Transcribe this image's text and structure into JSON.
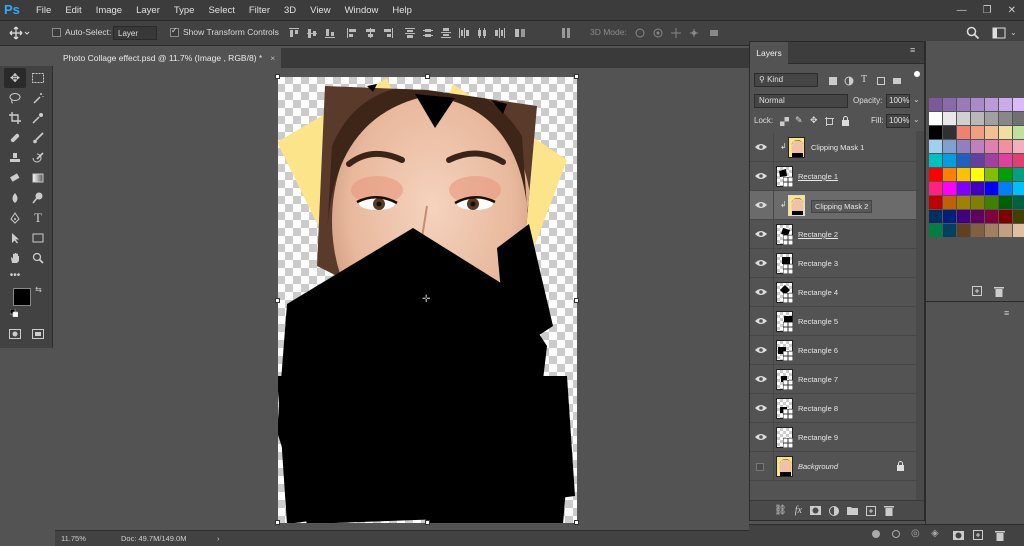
{
  "app": {
    "logo": "Ps"
  },
  "menu": [
    "File",
    "Edit",
    "Image",
    "Layer",
    "Type",
    "Select",
    "Filter",
    "3D",
    "View",
    "Window",
    "Help"
  ],
  "window_controls": {
    "minimize": "—",
    "restore": "❐",
    "close": "✕"
  },
  "options_bar": {
    "auto_select_label": "Auto-Select:",
    "auto_select_checked": false,
    "auto_select_target": "Layer",
    "show_transform_label": "Show Transform Controls",
    "show_transform_checked": true,
    "mode_3d_label": "3D Mode:"
  },
  "document": {
    "tab_title": "Photo Collage effect.psd @ 11.7% (Image , RGB/8) *",
    "close_glyph": "×"
  },
  "status_bar": {
    "zoom": "11.75%",
    "doc_info": "Doc: 49.7M/149.0M",
    "arrow": "›"
  },
  "layers_panel": {
    "tab_label": "Layers",
    "filter_kind": "Kind",
    "blend_mode": "Normal",
    "opacity_label": "Opacity:",
    "opacity_value": "100%",
    "lock_label": "Lock:",
    "fill_label": "Fill:",
    "fill_value": "100%",
    "layers": [
      {
        "name": "Clipping Mask 1",
        "visible": true,
        "clipped": true,
        "thumb": "face",
        "selected": false
      },
      {
        "name": "Rectangle 1",
        "visible": true,
        "clipped": false,
        "thumb": "shape",
        "selected": false,
        "underline": true
      },
      {
        "name": "Clipping Mask 2",
        "visible": true,
        "clipped": true,
        "thumb": "face",
        "selected": true
      },
      {
        "name": "Rectangle 2",
        "visible": true,
        "clipped": false,
        "thumb": "shape",
        "selected": false,
        "underline": true
      },
      {
        "name": "Rectangle 3",
        "visible": true,
        "clipped": false,
        "thumb": "shape",
        "selected": false
      },
      {
        "name": "Rectangle 4",
        "visible": true,
        "clipped": false,
        "thumb": "shape",
        "selected": false
      },
      {
        "name": "Rectangle 5",
        "visible": true,
        "clipped": false,
        "thumb": "shape",
        "selected": false
      },
      {
        "name": "Rectangle 6",
        "visible": true,
        "clipped": false,
        "thumb": "shape",
        "selected": false
      },
      {
        "name": "Rectangle 7",
        "visible": true,
        "clipped": false,
        "thumb": "shape",
        "selected": false
      },
      {
        "name": "Rectangle 8",
        "visible": true,
        "clipped": false,
        "thumb": "shape",
        "selected": false
      },
      {
        "name": "Rectangle 9",
        "visible": true,
        "clipped": false,
        "thumb": "shape",
        "selected": false
      },
      {
        "name": "Background",
        "visible": false,
        "clipped": false,
        "thumb": "face",
        "selected": false,
        "italic": true,
        "locked": true
      }
    ]
  },
  "swatches": [
    "#7a5a9a",
    "#8a6aaa",
    "#9a7aba",
    "#aa8aca",
    "#ba9ada",
    "#caaaea",
    "#dabafa",
    "#ffffff",
    "#e8e8e8",
    "#d0d0d0",
    "#b8b8b8",
    "#a0a0a0",
    "#888888",
    "#707070",
    "#000000",
    "#303030",
    "#f08070",
    "#f0a080",
    "#f0c090",
    "#f0e0a0",
    "#c0e0a0",
    "#a0d0f0",
    "#80a0d0",
    "#9080c0",
    "#c080c0",
    "#e080b0",
    "#f090a0",
    "#f0b0c0",
    "#00c0c0",
    "#00a0e0",
    "#2060c0",
    "#6040a0",
    "#a040a0",
    "#e040a0",
    "#e04070",
    "#ff0000",
    "#ff8000",
    "#ffc000",
    "#ffff00",
    "#80c000",
    "#00a000",
    "#00a080",
    "#ff2080",
    "#ff00ff",
    "#8000ff",
    "#4000c0",
    "#0000ff",
    "#0080ff",
    "#00c0ff",
    "#c00000",
    "#c06000",
    "#a08000",
    "#808000",
    "#408000",
    "#006000",
    "#006040",
    "#003060",
    "#002080",
    "#400080",
    "#600060",
    "#800040",
    "#800000",
    "#404000",
    "#008040",
    "#004060",
    "#604020",
    "#806040",
    "#a08060",
    "#c0a080",
    "#e0c0a0"
  ]
}
